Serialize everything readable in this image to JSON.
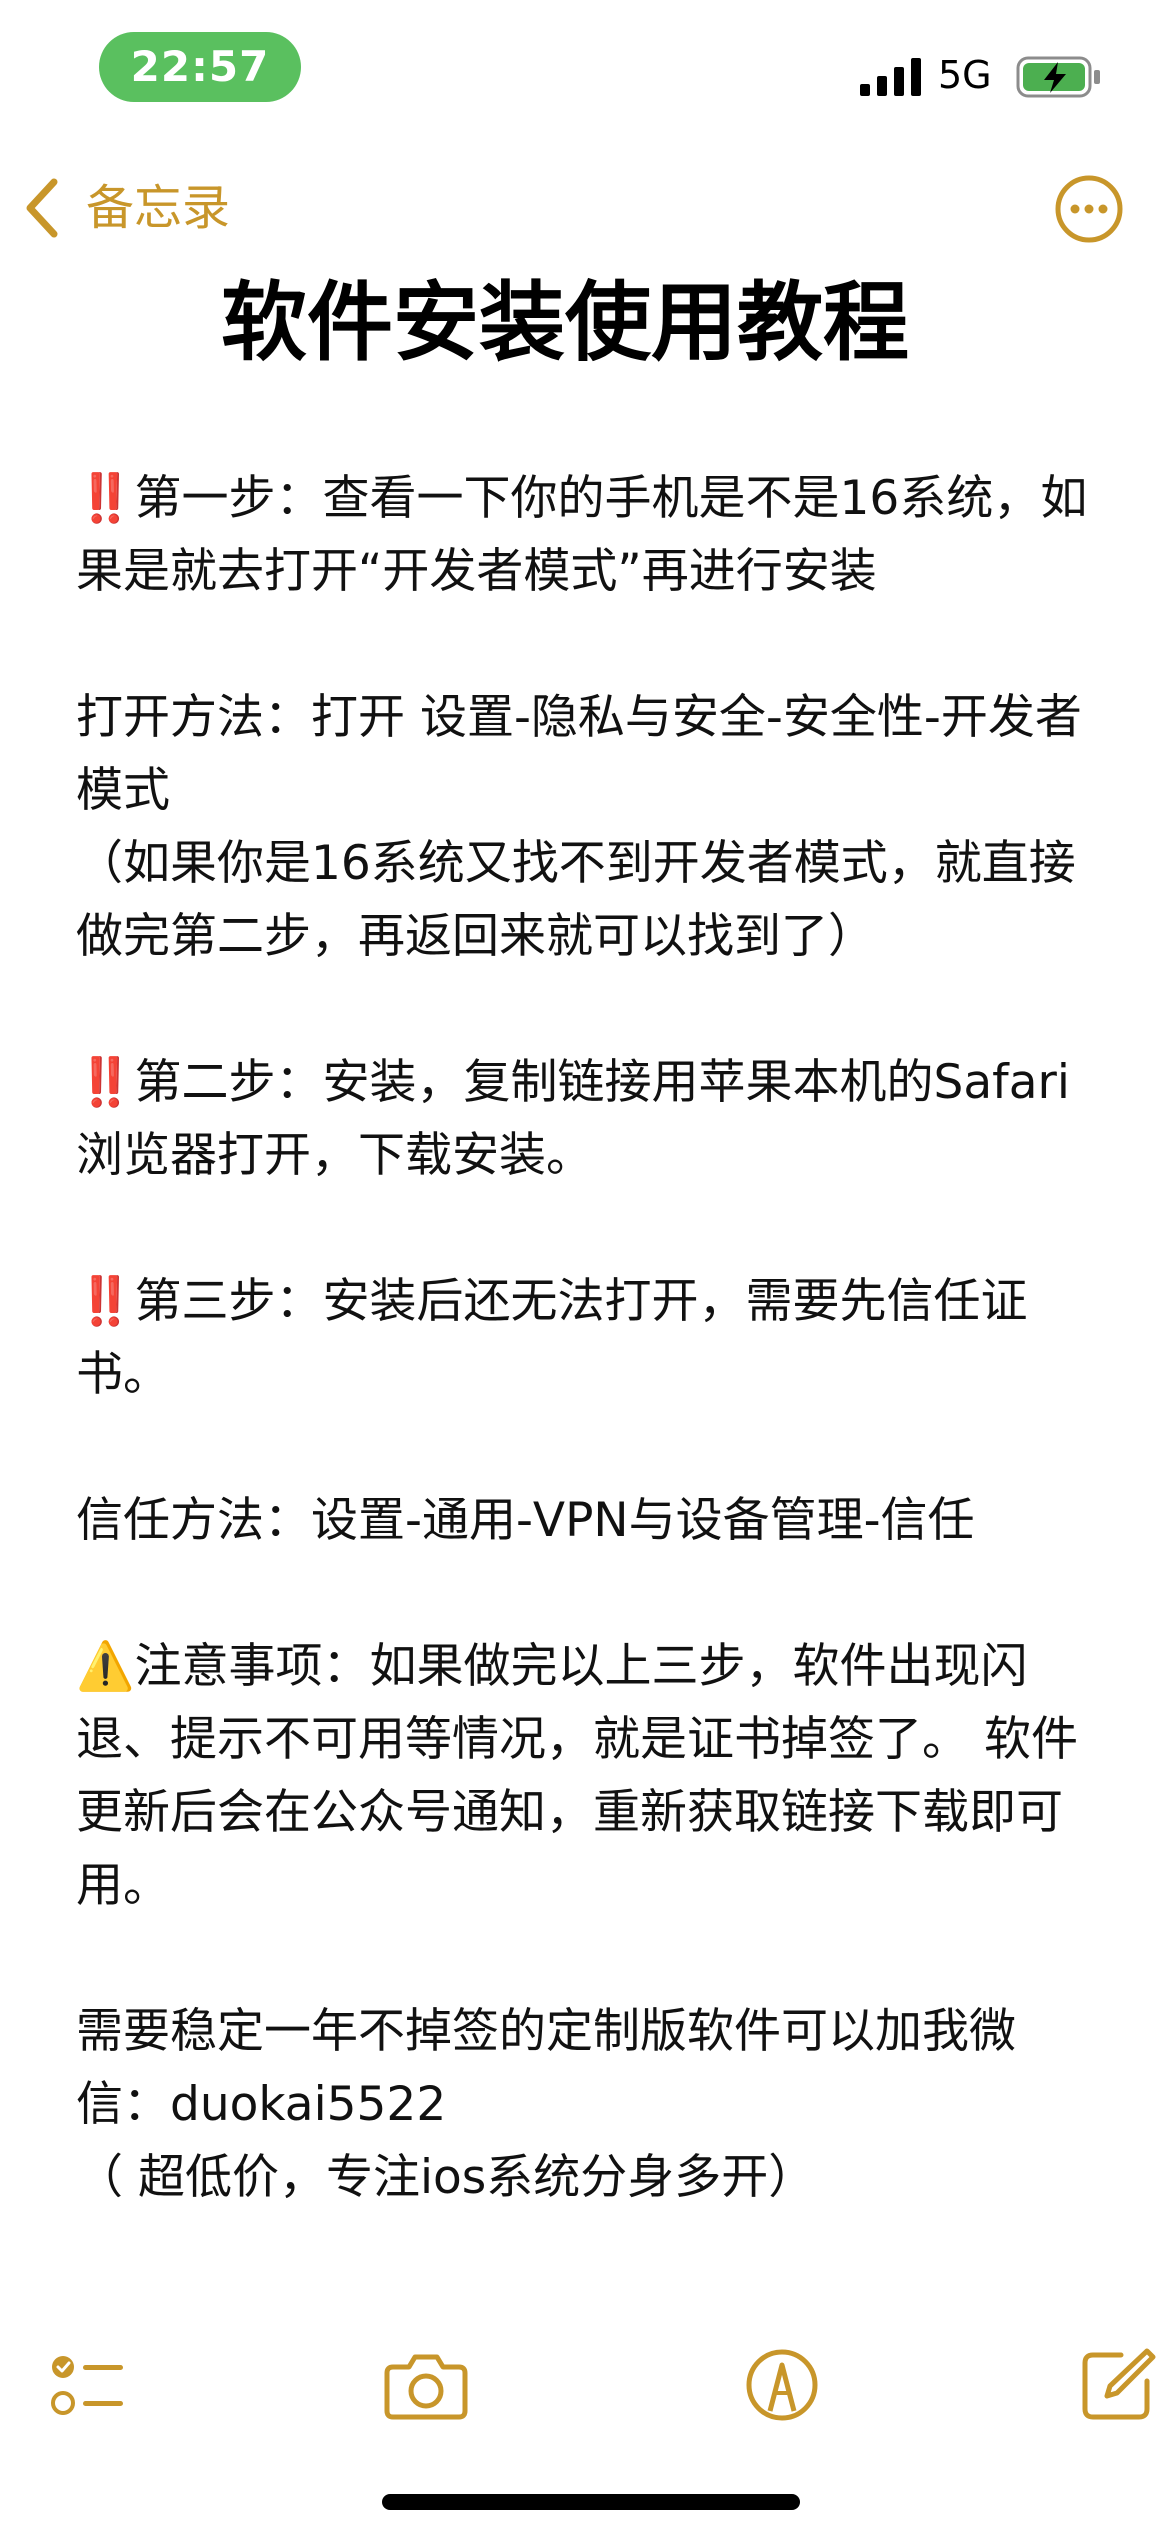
{
  "status_bar": {
    "time": "22:57",
    "network": "5G",
    "icons": [
      "signal-bars-icon",
      "charging-battery-icon"
    ]
  },
  "nav": {
    "back_label": "备忘录",
    "back_icon": "chevron-left-icon",
    "more_icon": "ellipsis-circle-icon"
  },
  "note": {
    "title": "软件安装使用教程",
    "paragraphs": [
      {
        "marker": "‼️",
        "text": "第一步：查看一下你的手机是不是16系统，如果是就去打开“开发者模式”再进行安装"
      },
      {
        "marker": "",
        "text": "打开方法：打开 设置-隐私与安全-安全性-开发者模式"
      },
      {
        "marker": "",
        "text": "（如果你是16系统又找不到开发者模式，就直接做完第二步，再返回来就可以找到了）"
      },
      {
        "marker": "‼️",
        "text": "第二步：安装，复制链接用苹果本机的Safari浏览器打开，下载安装。"
      },
      {
        "marker": "‼️",
        "text": "第三步：安装后还无法打开，需要先信任证书。"
      },
      {
        "marker": "",
        "text": "信任方法：设置-通用-VPN与设备管理-信任"
      },
      {
        "marker": "⚠️",
        "text": "注意事项：如果做完以上三步，软件出现闪退、提示不可用等情况，就是证书掉签了。 软件更新后会在公众号通知，重新获取链接下载即可用。"
      },
      {
        "marker": "",
        "text": "需要稳定一年不掉签的定制版软件可以加我微信：duokai5522"
      },
      {
        "marker": "",
        "text": "（ 超低价，专注ios系统分身多开）"
      }
    ]
  },
  "toolbar": {
    "icons": [
      "checklist-icon",
      "camera-icon",
      "markup-pen-icon",
      "compose-icon"
    ]
  },
  "colors": {
    "accent": "#c8962a",
    "time_pill": "#5ac05f",
    "battery_fill": "#4caf50",
    "alert_red": "#e0302e",
    "warning_yellow": "#f5c518"
  }
}
